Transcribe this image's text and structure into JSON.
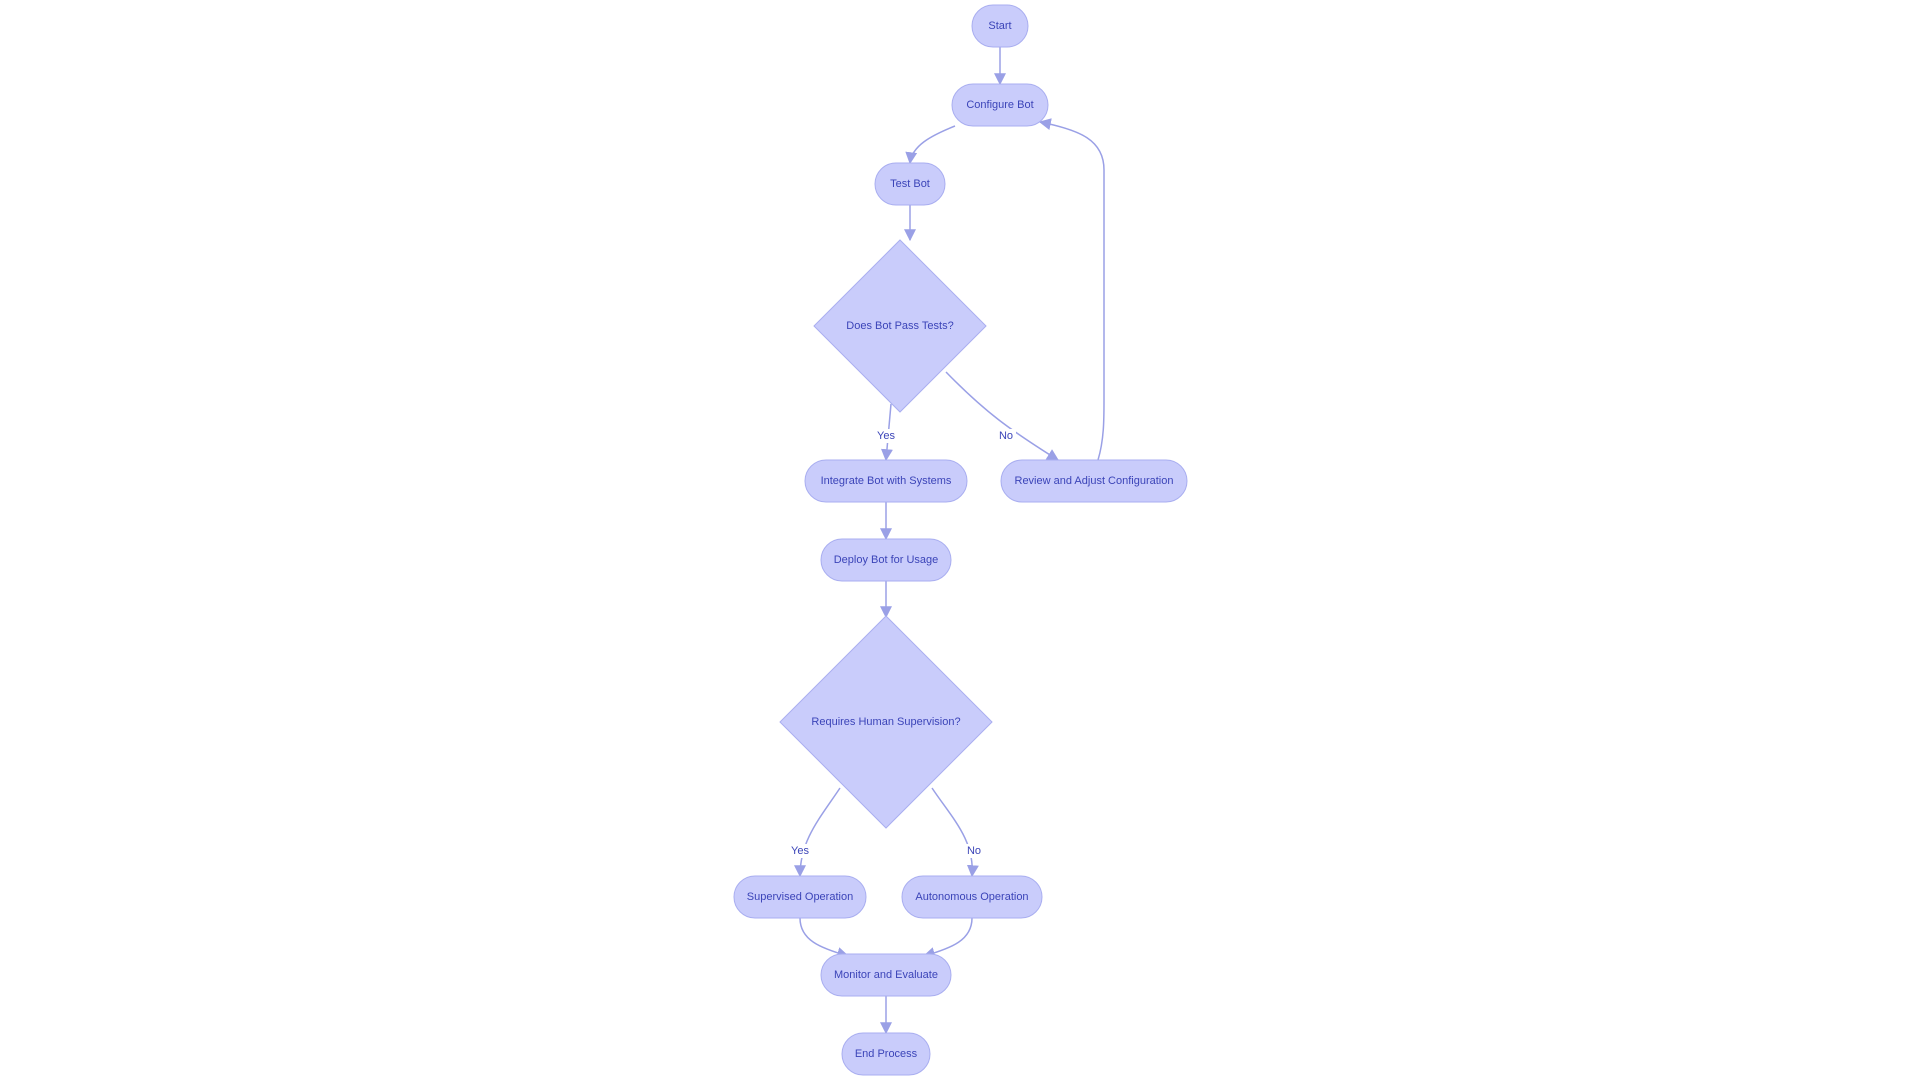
{
  "diagram": {
    "type": "flowchart",
    "colors": {
      "node_fill": "#c9ccfb",
      "node_stroke": "#a9aef0",
      "text": "#3b44b8",
      "edge": "#9aa0e6"
    },
    "nodes": [
      {
        "id": "start",
        "label": "Start",
        "shape": "rounded"
      },
      {
        "id": "configure",
        "label": "Configure Bot",
        "shape": "rounded"
      },
      {
        "id": "test",
        "label": "Test Bot",
        "shape": "rounded"
      },
      {
        "id": "pass",
        "label": "Does Bot Pass Tests?",
        "shape": "diamond"
      },
      {
        "id": "integrate",
        "label": "Integrate Bot with Systems",
        "shape": "rounded"
      },
      {
        "id": "review",
        "label": "Review and Adjust Configuration",
        "shape": "rounded"
      },
      {
        "id": "deploy",
        "label": "Deploy Bot for Usage",
        "shape": "rounded"
      },
      {
        "id": "supervision",
        "label": "Requires Human Supervision?",
        "shape": "diamond"
      },
      {
        "id": "supervised",
        "label": "Supervised Operation",
        "shape": "rounded"
      },
      {
        "id": "autonomous",
        "label": "Autonomous Operation",
        "shape": "rounded"
      },
      {
        "id": "monitor",
        "label": "Monitor and Evaluate",
        "shape": "rounded"
      },
      {
        "id": "end",
        "label": "End Process",
        "shape": "rounded"
      }
    ],
    "edges": [
      {
        "from": "start",
        "to": "configure",
        "label": ""
      },
      {
        "from": "configure",
        "to": "test",
        "label": ""
      },
      {
        "from": "test",
        "to": "pass",
        "label": ""
      },
      {
        "from": "pass",
        "to": "integrate",
        "label": "Yes"
      },
      {
        "from": "pass",
        "to": "review",
        "label": "No"
      },
      {
        "from": "review",
        "to": "configure",
        "label": ""
      },
      {
        "from": "integrate",
        "to": "deploy",
        "label": ""
      },
      {
        "from": "deploy",
        "to": "supervision",
        "label": ""
      },
      {
        "from": "supervision",
        "to": "supervised",
        "label": "Yes"
      },
      {
        "from": "supervision",
        "to": "autonomous",
        "label": "No"
      },
      {
        "from": "supervised",
        "to": "monitor",
        "label": ""
      },
      {
        "from": "autonomous",
        "to": "monitor",
        "label": ""
      },
      {
        "from": "monitor",
        "to": "end",
        "label": ""
      }
    ]
  }
}
